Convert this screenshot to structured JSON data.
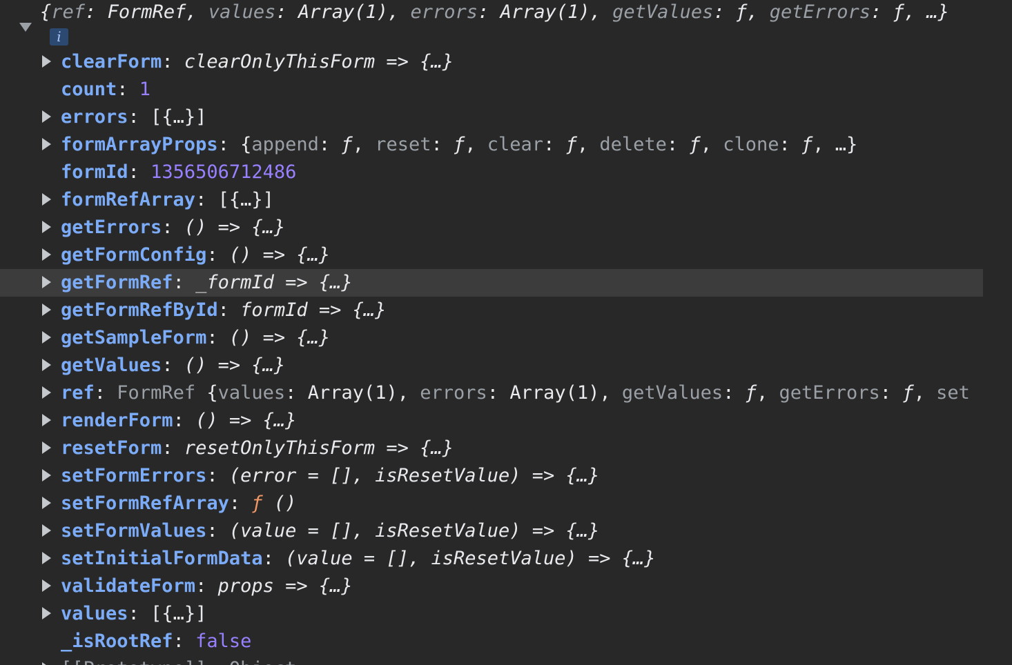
{
  "header": {
    "summary_ref_key": "ref",
    "summary_ref_val": "FormRef",
    "summary_values_key": "values",
    "summary_values_val": "Array(1)",
    "summary_errors_key": "errors",
    "summary_errors_val": "Array(1)",
    "summary_getvalues_key": "getValues",
    "summary_getvalues_val": "ƒ",
    "summary_geterrors_key": "getErrors",
    "summary_geterrors_val": "ƒ",
    "summary_more": "…",
    "info_badge": "i"
  },
  "rows": [
    {
      "key": "clearForm",
      "value": "clearOnlyThisForm => {…}"
    },
    {
      "key": "count",
      "value": "1"
    },
    {
      "key": "errors",
      "value": "[{…}]"
    },
    {
      "key": "formArrayProps",
      "value_parts": {
        "open": "{",
        "k1": "append",
        "v1": "ƒ",
        "k2": "reset",
        "v2": "ƒ",
        "k3": "clear",
        "v3": "ƒ",
        "k4": "delete",
        "v4": "ƒ",
        "k5": "clone",
        "v5": "ƒ",
        "more": "…}"
      }
    },
    {
      "key": "formId",
      "value": "1356506712486"
    },
    {
      "key": "formRefArray",
      "value": "[{…}]"
    },
    {
      "key": "getErrors",
      "value": "() => {…}"
    },
    {
      "key": "getFormConfig",
      "value": "() => {…}"
    },
    {
      "key": "getFormRef",
      "value": "_formId => {…}"
    },
    {
      "key": "getFormRefById",
      "value": "formId => {…}"
    },
    {
      "key": "getSampleForm",
      "value": "() => {…}"
    },
    {
      "key": "getValues",
      "value": "() => {…}"
    },
    {
      "key": "ref",
      "value_parts": {
        "cls": "FormRef",
        "open": "{",
        "k1": "values",
        "v1": "Array(1)",
        "k2": "errors",
        "v2": "Array(1)",
        "k3": "getValues",
        "v3": "ƒ",
        "k4": "getErrors",
        "v4": "ƒ",
        "k5": "set"
      }
    },
    {
      "key": "renderForm",
      "value": "() => {…}"
    },
    {
      "key": "resetForm",
      "value": "resetOnlyThisForm => {…}"
    },
    {
      "key": "setFormErrors",
      "value": "(error = [], isResetValue) => {…}"
    },
    {
      "key": "setFormRefArray",
      "value_f": "ƒ",
      "value_rest": "()"
    },
    {
      "key": "setFormValues",
      "value": "(value = [], isResetValue) => {…}"
    },
    {
      "key": "setInitialFormData",
      "value": "(value = [], isResetValue) => {…}"
    },
    {
      "key": "validateForm",
      "value": "props => {…}"
    },
    {
      "key": "values",
      "value": "[{…}]"
    },
    {
      "key": "_isRootRef",
      "value": "false"
    }
  ],
  "partial_last_row": "[[Prototype]]: Object"
}
